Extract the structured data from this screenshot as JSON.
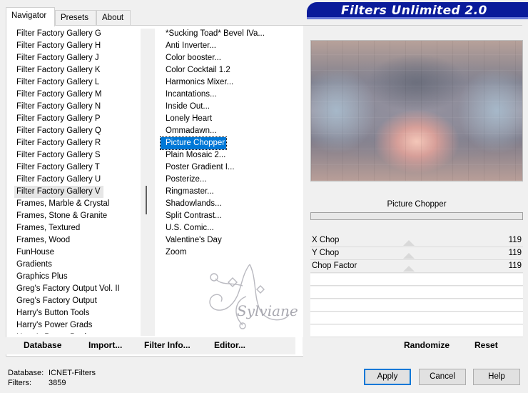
{
  "window": {
    "title": "Filters Unlimited 2.0"
  },
  "tabs": [
    {
      "label": "Navigator",
      "active": true
    },
    {
      "label": "Presets",
      "active": false
    },
    {
      "label": "About",
      "active": false
    }
  ],
  "categories": [
    "Filter Factory Gallery G",
    "Filter Factory Gallery H",
    "Filter Factory Gallery J",
    "Filter Factory Gallery K",
    "Filter Factory Gallery L",
    "Filter Factory Gallery M",
    "Filter Factory Gallery N",
    "Filter Factory Gallery P",
    "Filter Factory Gallery Q",
    "Filter Factory Gallery R",
    "Filter Factory Gallery S",
    "Filter Factory Gallery T",
    "Filter Factory Gallery U",
    "Filter Factory Gallery V",
    "Frames, Marble & Crystal",
    "Frames, Stone & Granite",
    "Frames, Textured",
    "Frames, Wood",
    "FunHouse",
    "Gradients",
    "Graphics Plus",
    "Greg's Factory Output Vol. II",
    "Greg's Factory Output",
    "Harry's Button Tools",
    "Harry's Power Grads",
    "Harry's Power Pools"
  ],
  "current_category": "Filter Factory Gallery V",
  "filters": [
    "*Sucking Toad*  Bevel IVa...",
    "Anti Inverter...",
    "Color booster...",
    "Color Cocktail 1.2",
    "Harmonics Mixer...",
    "Incantations...",
    "Inside Out...",
    "Lonely Heart",
    "Ommadawn...",
    "Picture Chopper",
    "Plain Mosaic 2...",
    "Poster Gradient I...",
    "Posterize...",
    "Ringmaster...",
    "Shadowlands...",
    "Split Contrast...",
    "U.S. Comic...",
    "Valentine's Day",
    "Zoom"
  ],
  "selected_filter": "Picture Chopper",
  "params": {
    "title": "Picture Chopper",
    "items": [
      {
        "label": "X Chop",
        "value": "119"
      },
      {
        "label": "Y Chop",
        "value": "119"
      },
      {
        "label": "Chop Factor",
        "value": "119"
      }
    ]
  },
  "watermark": {
    "text": "Sylviane"
  },
  "left_buttons": {
    "database": "Database",
    "import": "Import...",
    "filter_info": "Filter Info...",
    "editor": "Editor..."
  },
  "right_buttons": {
    "randomize": "Randomize",
    "reset": "Reset"
  },
  "status": {
    "database_label": "Database:",
    "database_value": "ICNET-Filters",
    "filters_label": "Filters:",
    "filters_value": "3859"
  },
  "dialog_buttons": {
    "apply": "Apply",
    "cancel": "Cancel",
    "help": "Help"
  }
}
